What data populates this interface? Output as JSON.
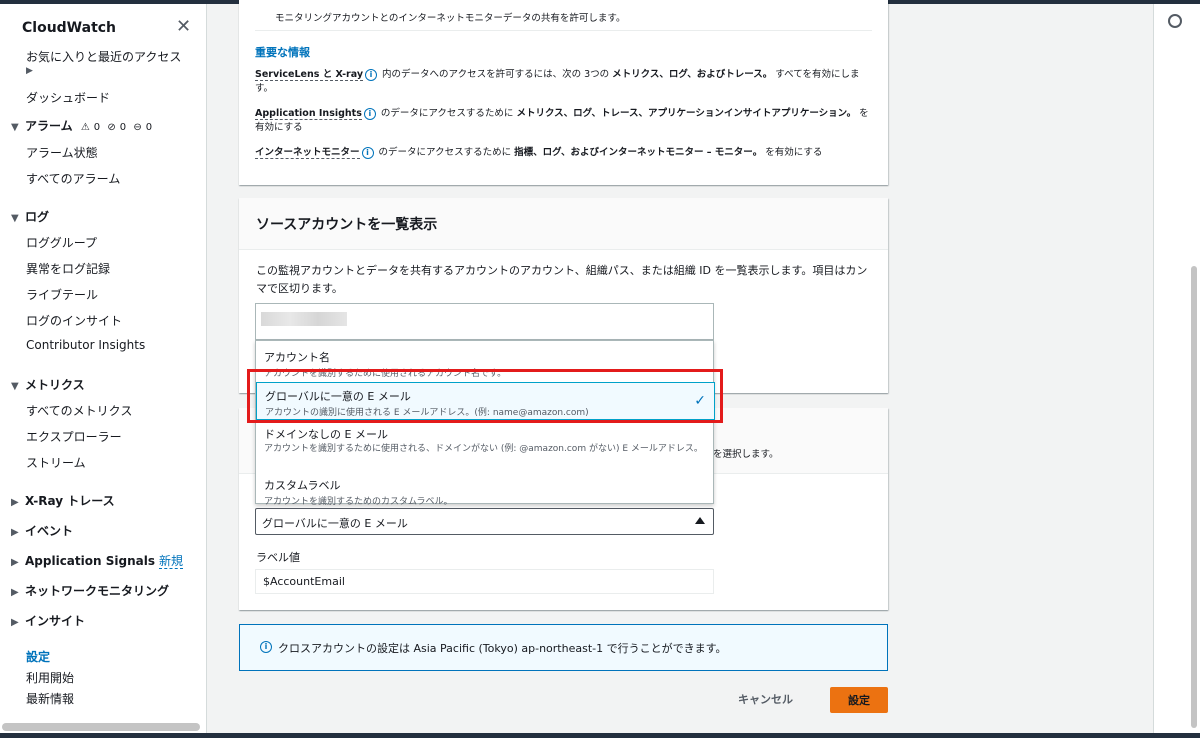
{
  "sidebar": {
    "title": "CloudWatch",
    "favorites": "お気に入りと最近のアクセス",
    "dashboard": "ダッシュボード",
    "alarms": {
      "label": "アラーム",
      "counts": [
        "0",
        "0",
        "0"
      ]
    },
    "alarm_state": "アラーム状態",
    "all_alarms": "すべてのアラーム",
    "logs": "ログ",
    "log_groups": "ロググループ",
    "log_anomaly": "異常をログ記録",
    "live_tail": "ライブテール",
    "log_insights": "ログのインサイト",
    "contributor_insights": "Contributor Insights",
    "metrics": "メトリクス",
    "all_metrics": "すべてのメトリクス",
    "explorer": "エクスプローラー",
    "streams": "ストリーム",
    "xray": "X-Ray トレース",
    "events": "イベント",
    "app_signals": "Application Signals",
    "new_badge": "新規",
    "network": "ネットワークモニタリング",
    "insights": "インサイト",
    "settings": "設定",
    "getting_started": "利用開始",
    "whats_new": "最新情報"
  },
  "card1": {
    "top_text": "モニタリングアカウントとのインターネットモニターデータの共有を許可します。",
    "important_head": "重要な情報",
    "line1": {
      "prefix": "ServiceLens と X-ray",
      "text": "内のデータへのアクセスを許可するには、次の 3つの",
      "bold": "メトリクス、ログ、およびトレース。",
      "suffix": "すべてを有効にします。"
    },
    "line2": {
      "prefix": "Application Insights",
      "text": "のデータにアクセスするために",
      "bold": "メトリクス、ログ、トレース、アプリケーションインサイトアプリケーション。",
      "suffix": "を有効にする"
    },
    "line3": {
      "prefix": "インターネットモニター",
      "text": "のデータにアクセスするために",
      "bold": "指標、ログ、およびインターネットモニター – モニター。",
      "suffix": "を有効にする"
    }
  },
  "card2": {
    "title": "ソースアカウントを一覧表示",
    "description": "この監視アカウントとデータを共有するアカウントのアカウント、組織パス、または組織 ID を一覧表示します。項目はカンマで区切ります。"
  },
  "card3": {
    "hint": "を選択します。",
    "selected_value": "グローバルに一意の E メール",
    "label_value_label": "ラベル値",
    "label_value": "$AccountEmail"
  },
  "dropdown": {
    "options": [
      {
        "title": "アカウント名",
        "desc": "アカウントを識別するために使用されるアカウント名です。"
      },
      {
        "title": "グローバルに一意の E メール",
        "desc": "アカウントの識別に使用される E メールアドレス。(例: name@amazon.com)"
      },
      {
        "title": "ドメインなしの E メール",
        "desc": "アカウントを識別するために使用される、ドメインがない (例: @amazon.com がない) E メールアドレス。"
      },
      {
        "title": "カスタムラベル",
        "desc": "アカウントを識別するためのカスタムラベル。"
      }
    ]
  },
  "infobar": {
    "text": "クロスアカウントの設定は Asia Pacific (Tokyo) ap-northeast-1 で行うことができます。"
  },
  "buttons": {
    "cancel": "キャンセル",
    "submit": "設定"
  },
  "colors": {
    "accent": "#0073bb",
    "primary_button": "#ec7211",
    "highlight": "#e31b1b"
  }
}
